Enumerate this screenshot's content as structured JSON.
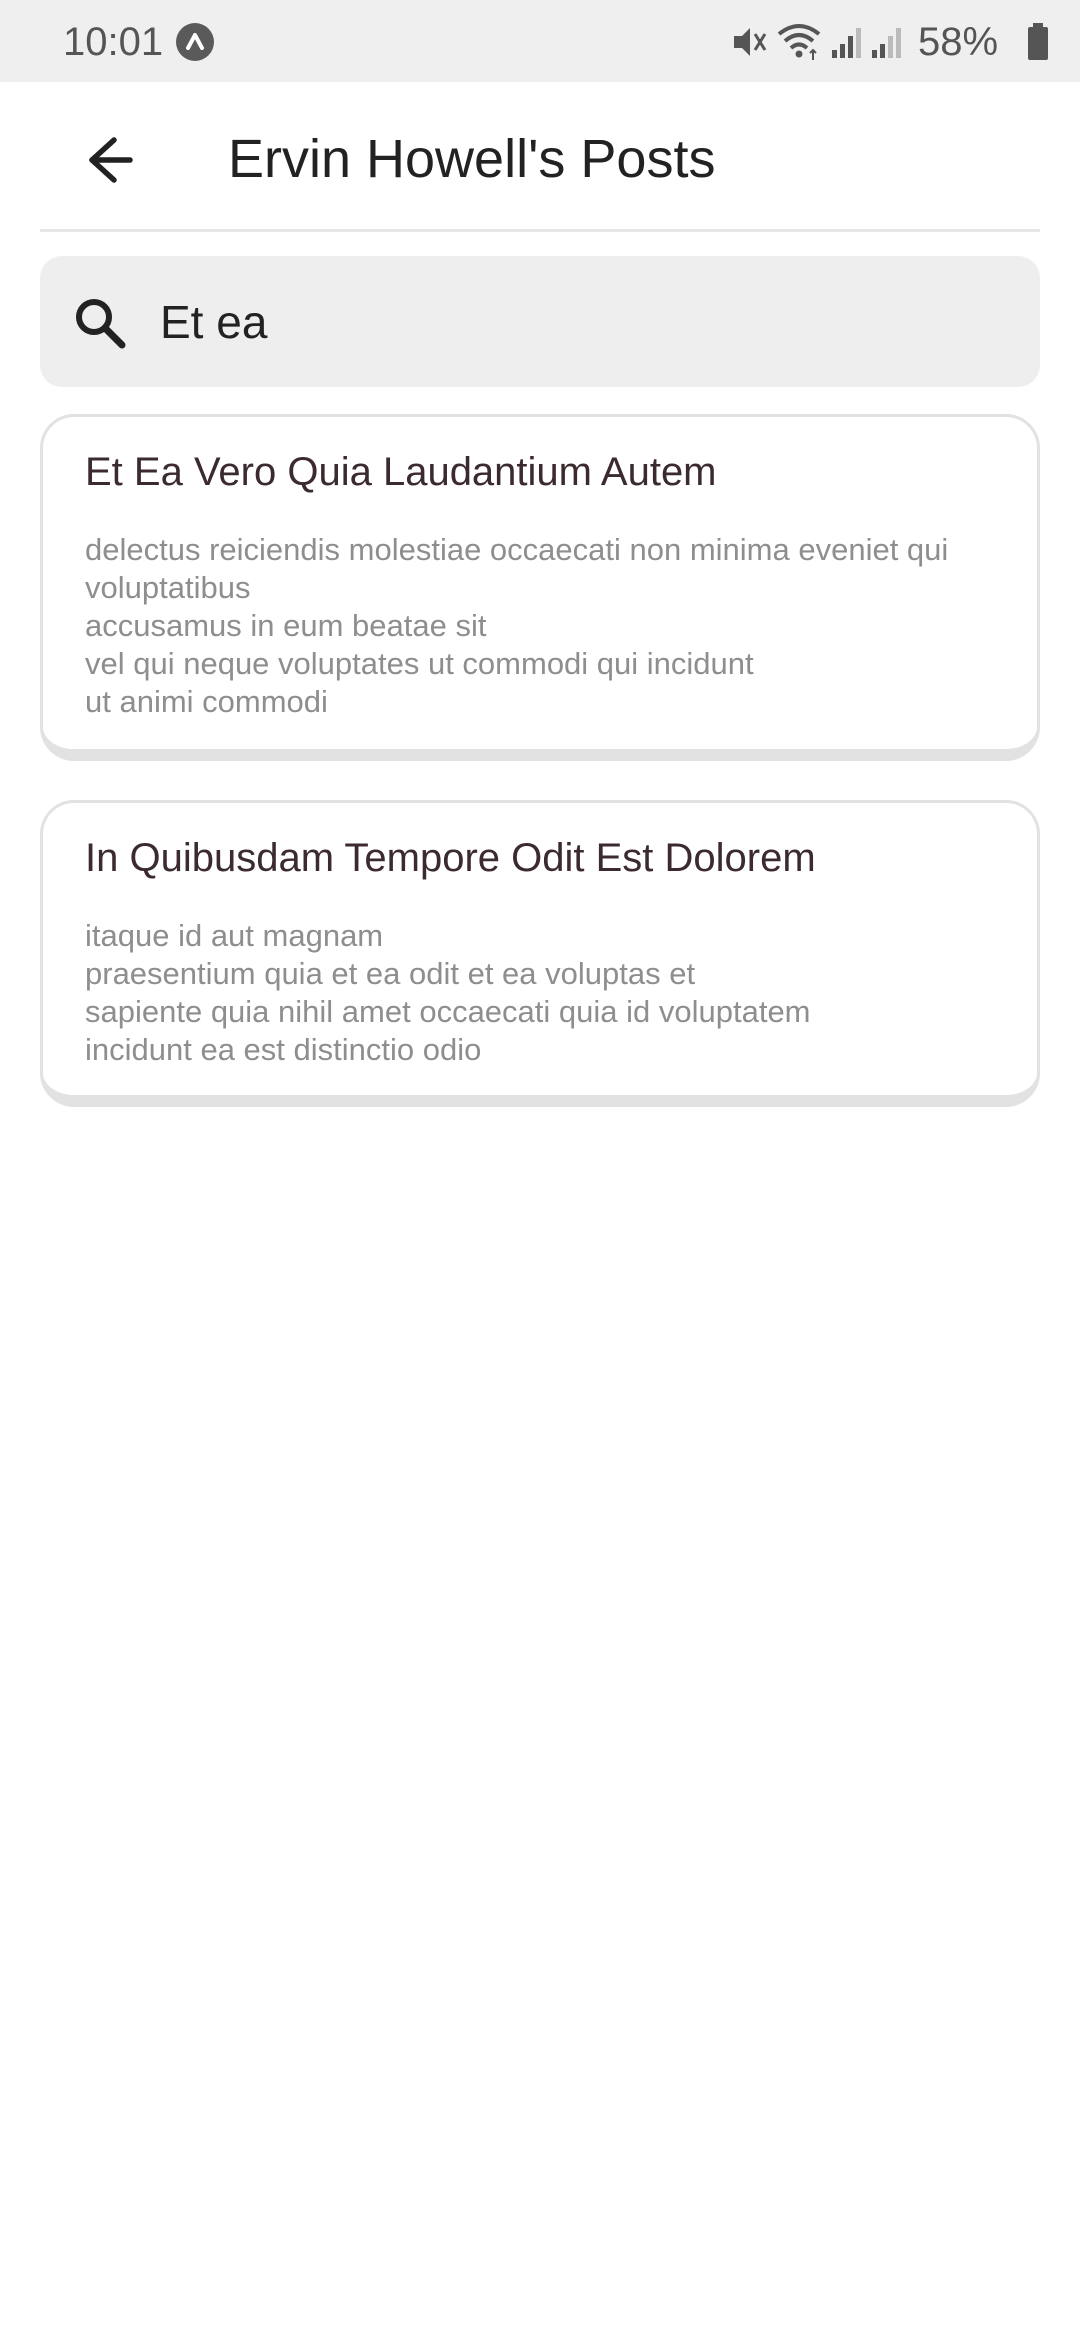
{
  "status_bar": {
    "time": "10:01",
    "battery": "58%",
    "icons": [
      "app-indicator-icon",
      "mute-icon",
      "wifi-icon",
      "signal-icon",
      "signal-icon",
      "battery-icon"
    ]
  },
  "app_bar": {
    "title": "Ervin Howell's Posts",
    "back_icon": "arrow-back-icon"
  },
  "search": {
    "icon": "search-icon",
    "value": "Et ea"
  },
  "posts": [
    {
      "title": "Et Ea Vero Quia Laudantium Autem",
      "body_lines": [
        "delectus reiciendis molestiae occaecati non minima eveniet qui voluptatibus",
        "accusamus in eum beatae sit",
        "vel qui neque voluptates ut commodi qui incidunt",
        "ut animi commodi"
      ]
    },
    {
      "title": "In Quibusdam Tempore Odit Est Dolorem",
      "body_lines": [
        "itaque id aut magnam",
        "praesentium quia et ea odit et ea voluptas et",
        "sapiente quia nihil amet occaecati quia id voluptatem",
        "incidunt ea est distinctio odio"
      ]
    }
  ],
  "colors": {
    "status_bar_bg": "#efefef",
    "search_bg": "#eeeeee",
    "title_text": "#3b2a2e",
    "body_text": "#8e8e8e",
    "card_border": "#e2e2e2"
  }
}
